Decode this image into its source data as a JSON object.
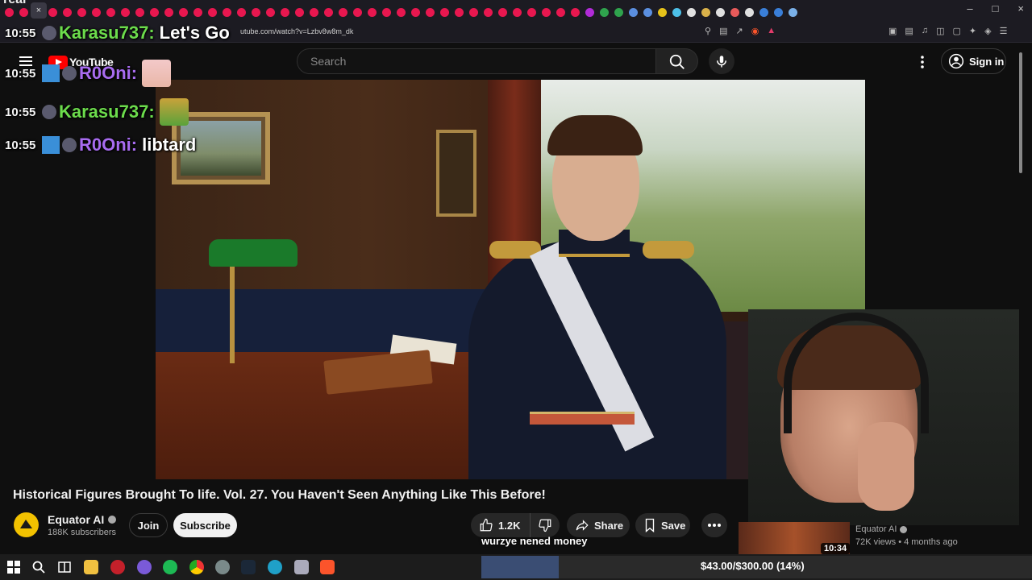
{
  "browser": {
    "tab_peek": "real",
    "tab_close": "×",
    "url": "utube.com/watch?v=Lzbv8w8m_dk",
    "window_controls": [
      "–",
      "□",
      "×"
    ],
    "tab_colors": [
      "#e8174f",
      "#e8174f",
      "#e8174f",
      "#e8174f",
      "#e8174f",
      "#e8174f",
      "#e8174f",
      "#e8174f",
      "#e8174f",
      "#e8174f",
      "#e8174f",
      "#e8174f",
      "#e8174f",
      "#e8174f",
      "#e8174f",
      "#e8174f",
      "#e8174f",
      "#e8174f",
      "#e8174f",
      "#e8174f",
      "#e8174f",
      "#e8174f",
      "#e8174f",
      "#e8174f",
      "#e8174f",
      "#e8174f",
      "#e8174f",
      "#e8174f",
      "#e8174f",
      "#e8174f",
      "#e8174f",
      "#e8174f",
      "#e8174f",
      "#e8174f",
      "#e8174f",
      "#e8174f",
      "#e8174f",
      "#e8174f",
      "#e8174f",
      "#e8174f",
      "#b12bd8",
      "#2fa34d",
      "#2fa34d",
      "#5b8fe0",
      "#5b8fe0",
      "#e6c21a",
      "#4dc0e8",
      "#e0e0e0",
      "#d9b14a",
      "#e0e0e0",
      "#e85a5a",
      "#e0e0e0",
      "#3a7fd8",
      "#3a7fd8",
      "#7ab0e8"
    ]
  },
  "youtube": {
    "logo_text": "YouTube",
    "search_placeholder": "Search",
    "sign_in": "Sign in"
  },
  "chat": [
    {
      "time": "10:55",
      "user": "Karasu737",
      "color": "green",
      "message": "Let's Go"
    },
    {
      "time": "10:55",
      "user": "R0Oni",
      "color": "purple",
      "message": ""
    },
    {
      "time": "10:55",
      "user": "Karasu737",
      "color": "green",
      "message": ""
    },
    {
      "time": "10:55",
      "user": "R0Oni",
      "color": "purple",
      "message": "libtard"
    }
  ],
  "video": {
    "title": "Historical Figures Brought To life. Vol. 27. You Haven't Seen Anything Like This Before!",
    "channel": "Equator AI",
    "subscribers": "188K subscribers",
    "join": "Join",
    "subscribe": "Subscribe",
    "likes": "1.2K",
    "share": "Share",
    "save": "Save",
    "caption": "wurzye nened money"
  },
  "recommended": {
    "channel": "Equator AI",
    "meta": "72K views • 4 months ago",
    "duration": "10:34"
  },
  "stream_goal": {
    "text": "$43.00/$300.00 (14%)",
    "progress": 0.14,
    "fill_color": "#3a4d73"
  },
  "colors": {
    "yt_red": "#ff0000",
    "chat_green": "#6cdc4c",
    "chat_purple": "#a86cf0"
  }
}
